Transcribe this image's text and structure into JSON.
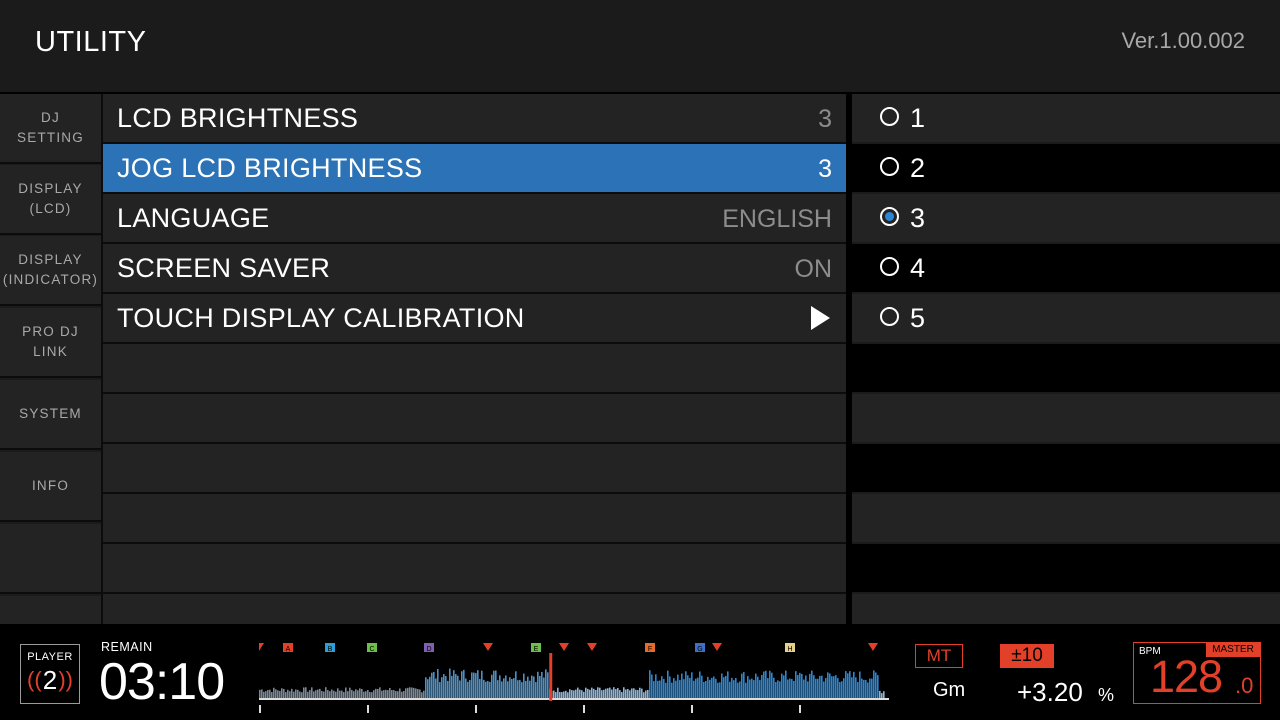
{
  "header": {
    "title": "UTILITY",
    "version": "Ver.1.00.002"
  },
  "sidebar": {
    "items": [
      {
        "label": "DJ\nSETTING",
        "active": false
      },
      {
        "label": "DISPLAY\n(LCD)",
        "active": true
      },
      {
        "label": "DISPLAY\n(INDICATOR)",
        "active": false
      },
      {
        "label": "PRO DJ\nLINK",
        "active": false
      },
      {
        "label": "SYSTEM",
        "active": false
      },
      {
        "label": "INFO",
        "active": false
      },
      {
        "label": "",
        "active": false
      }
    ]
  },
  "menu": {
    "items": [
      {
        "label": "LCD BRIGHTNESS",
        "value": "3",
        "selected": false
      },
      {
        "label": "JOG LCD BRIGHTNESS",
        "value": "3",
        "selected": true
      },
      {
        "label": "LANGUAGE",
        "value": "ENGLISH",
        "selected": false
      },
      {
        "label": "SCREEN SAVER",
        "value": "ON",
        "selected": false
      },
      {
        "label": "TOUCH DISPLAY CALIBRATION",
        "value": "",
        "selected": false,
        "icon": "play-arrow-icon"
      }
    ]
  },
  "options": {
    "items": [
      {
        "label": "1",
        "checked": false
      },
      {
        "label": "2",
        "checked": false
      },
      {
        "label": "3",
        "checked": true
      },
      {
        "label": "4",
        "checked": false
      },
      {
        "label": "5",
        "checked": false
      }
    ]
  },
  "deck": {
    "player_label": "PLAYER",
    "player_number": "2",
    "remain_label": "REMAIN",
    "time": "03:10",
    "playhead_fraction": 0.46,
    "cue_markers": [
      "A",
      "B",
      "C",
      "D",
      "E",
      "F",
      "G",
      "H"
    ],
    "master_tempo": "MT",
    "key": "Gm",
    "tempo_range": "±10",
    "tempo_value": "+3.20",
    "tempo_unit": "%",
    "bpm_label": "BPM",
    "master_label": "MASTER",
    "bpm_value": "128",
    "bpm_decimal": ".0"
  },
  "colors": {
    "selected_row": "#2b73b6",
    "radio_checked": "#2b86d8",
    "accent": "#e3402a",
    "waveform": "#3a8fd0"
  }
}
